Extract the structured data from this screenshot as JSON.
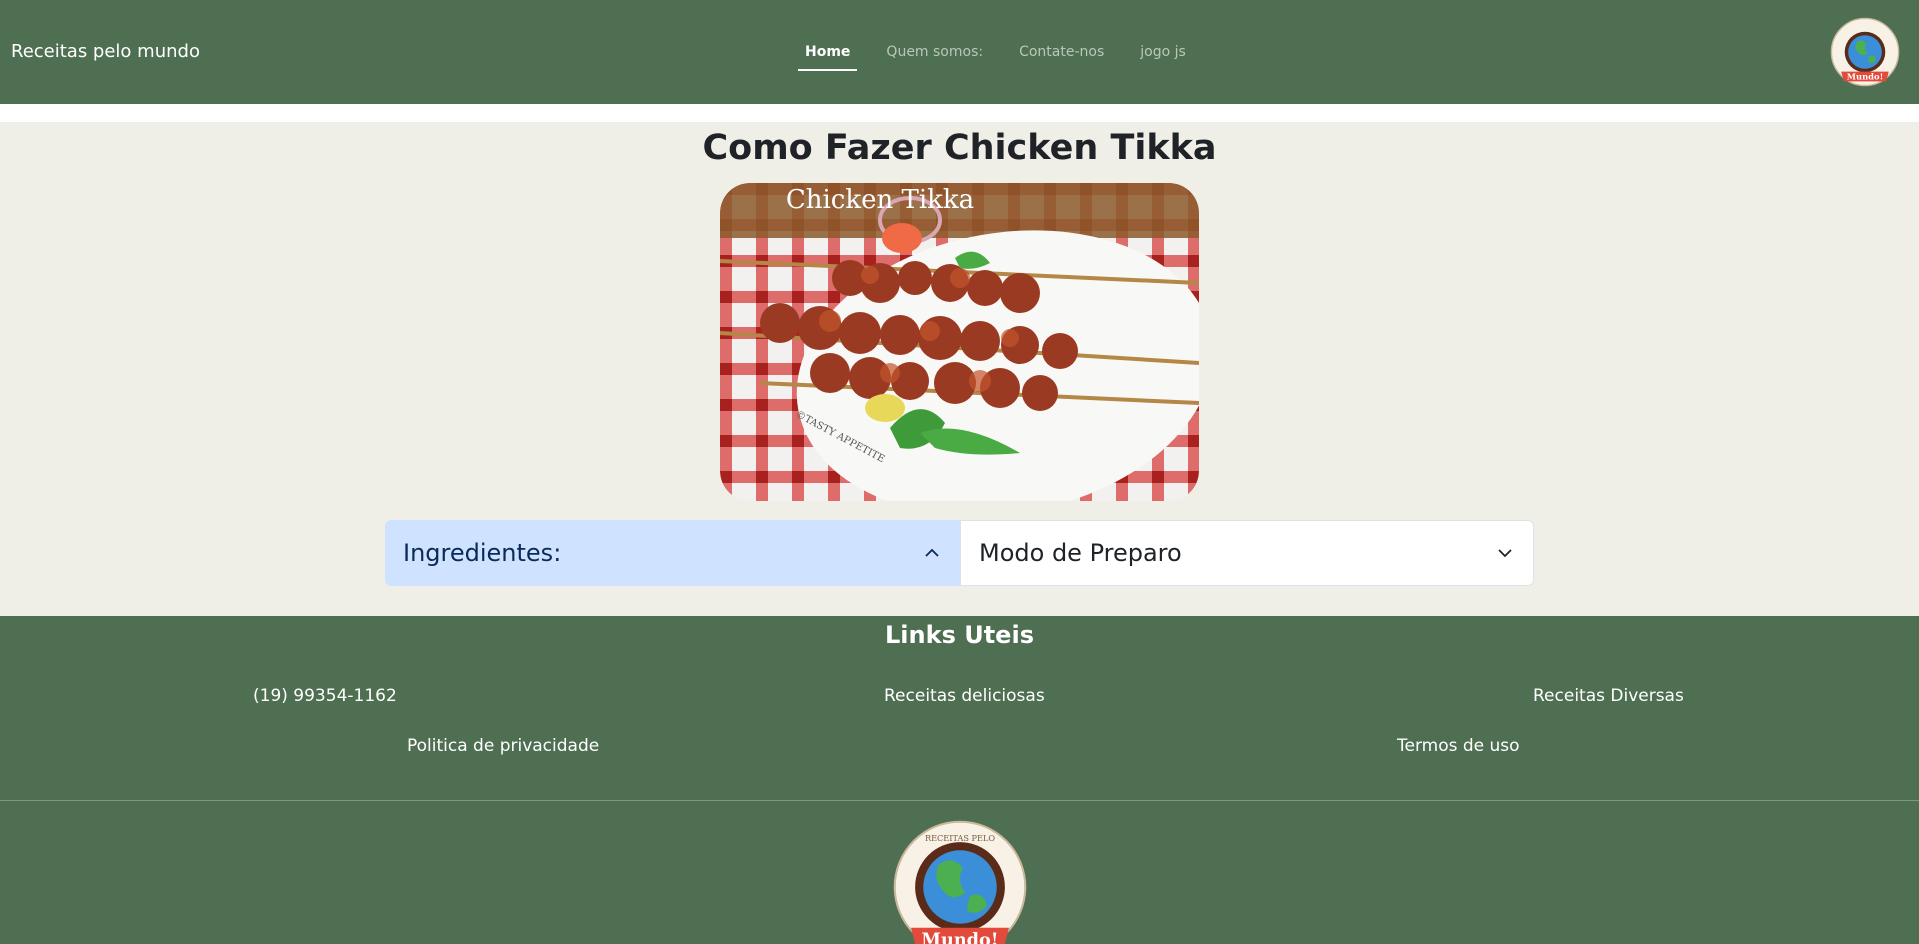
{
  "navbar": {
    "brand": "Receitas pelo mundo",
    "links": [
      {
        "label": "Home",
        "active": true
      },
      {
        "label": "Quem somos:",
        "active": false
      },
      {
        "label": "Contate-nos",
        "active": false
      },
      {
        "label": "jogo js",
        "active": false
      }
    ],
    "logo": {
      "top_text": "RECEITAS PELO",
      "bottom_text": "Mundo!"
    }
  },
  "main": {
    "title": "Como Fazer Chicken Tikka",
    "image": {
      "caption": "Chicken Tikka",
      "watermark": "©TASTY APPETITE"
    },
    "accordion": [
      {
        "label": "Ingredientes:",
        "expanded": true
      },
      {
        "label": "Modo de Preparo",
        "expanded": false
      }
    ]
  },
  "footer": {
    "title": "Links Uteis",
    "links": {
      "phone": "(19) 99354-1162",
      "recipes_delicious": "Receitas deliciosas",
      "recipes_diverse": "Receitas Diversas",
      "privacy": "Politica de privacidade",
      "terms": "Termos de uso"
    },
    "logo": {
      "top_text": "RECEITAS PELO",
      "bottom_text": "Mundo!"
    }
  },
  "colors": {
    "navbar_bg": "#4f6f52",
    "main_bg": "#f0efe7",
    "accordion_open_bg": "#cfe2ff"
  }
}
